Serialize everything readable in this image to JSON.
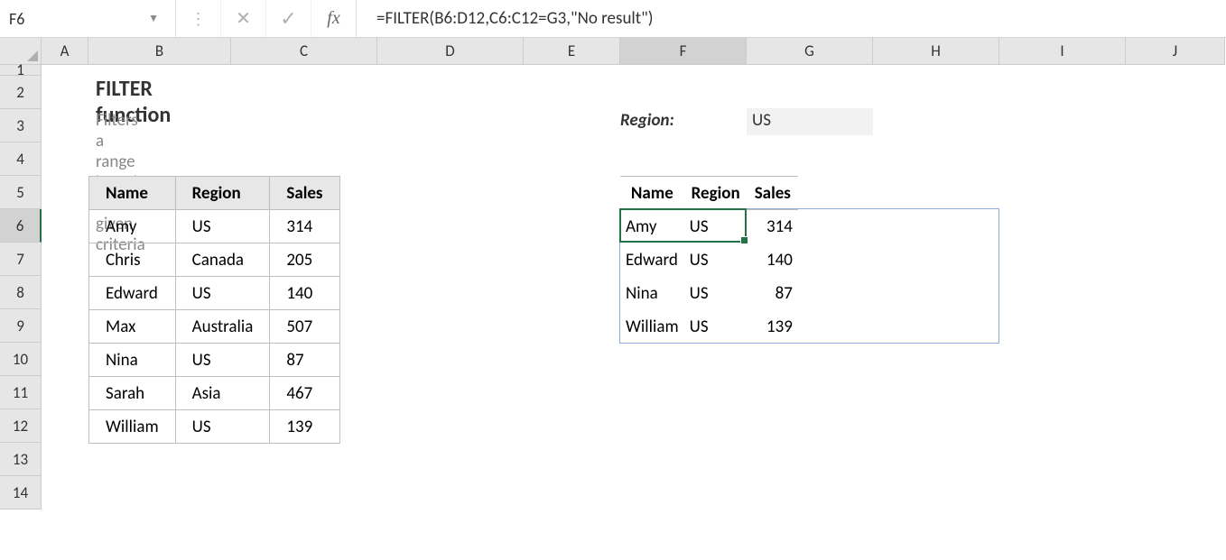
{
  "nameBox": "F6",
  "formula": "=FILTER(B6:D12,C6:C12=G3,\"No result\")",
  "fxLabel": "fx",
  "columns": [
    "A",
    "B",
    "C",
    "D",
    "E",
    "F",
    "G",
    "H",
    "I",
    "J"
  ],
  "rows": [
    "1",
    "2",
    "3",
    "4",
    "5",
    "6",
    "7",
    "8",
    "9",
    "10",
    "11",
    "12",
    "13",
    "14"
  ],
  "title": "FILTER function",
  "subtitle": "Filters a range based on given criteria",
  "regionLabel": "Region:",
  "regionValue": "US",
  "sourceHeaders": [
    "Name",
    "Region",
    "Sales"
  ],
  "sourceData": [
    [
      "Amy",
      "US",
      "314"
    ],
    [
      "Chris",
      "Canada",
      "205"
    ],
    [
      "Edward",
      "US",
      "140"
    ],
    [
      "Max",
      "Australia",
      "507"
    ],
    [
      "Nina",
      "US",
      "87"
    ],
    [
      "Sarah",
      "Asia",
      "467"
    ],
    [
      "William",
      "US",
      "139"
    ]
  ],
  "resultHeaders": [
    "Name",
    "Region",
    "Sales"
  ],
  "resultData": [
    [
      "Amy",
      "US",
      "314"
    ],
    [
      "Edward",
      "US",
      "140"
    ],
    [
      "Nina",
      "US",
      "87"
    ],
    [
      "William",
      "US",
      "139"
    ]
  ]
}
